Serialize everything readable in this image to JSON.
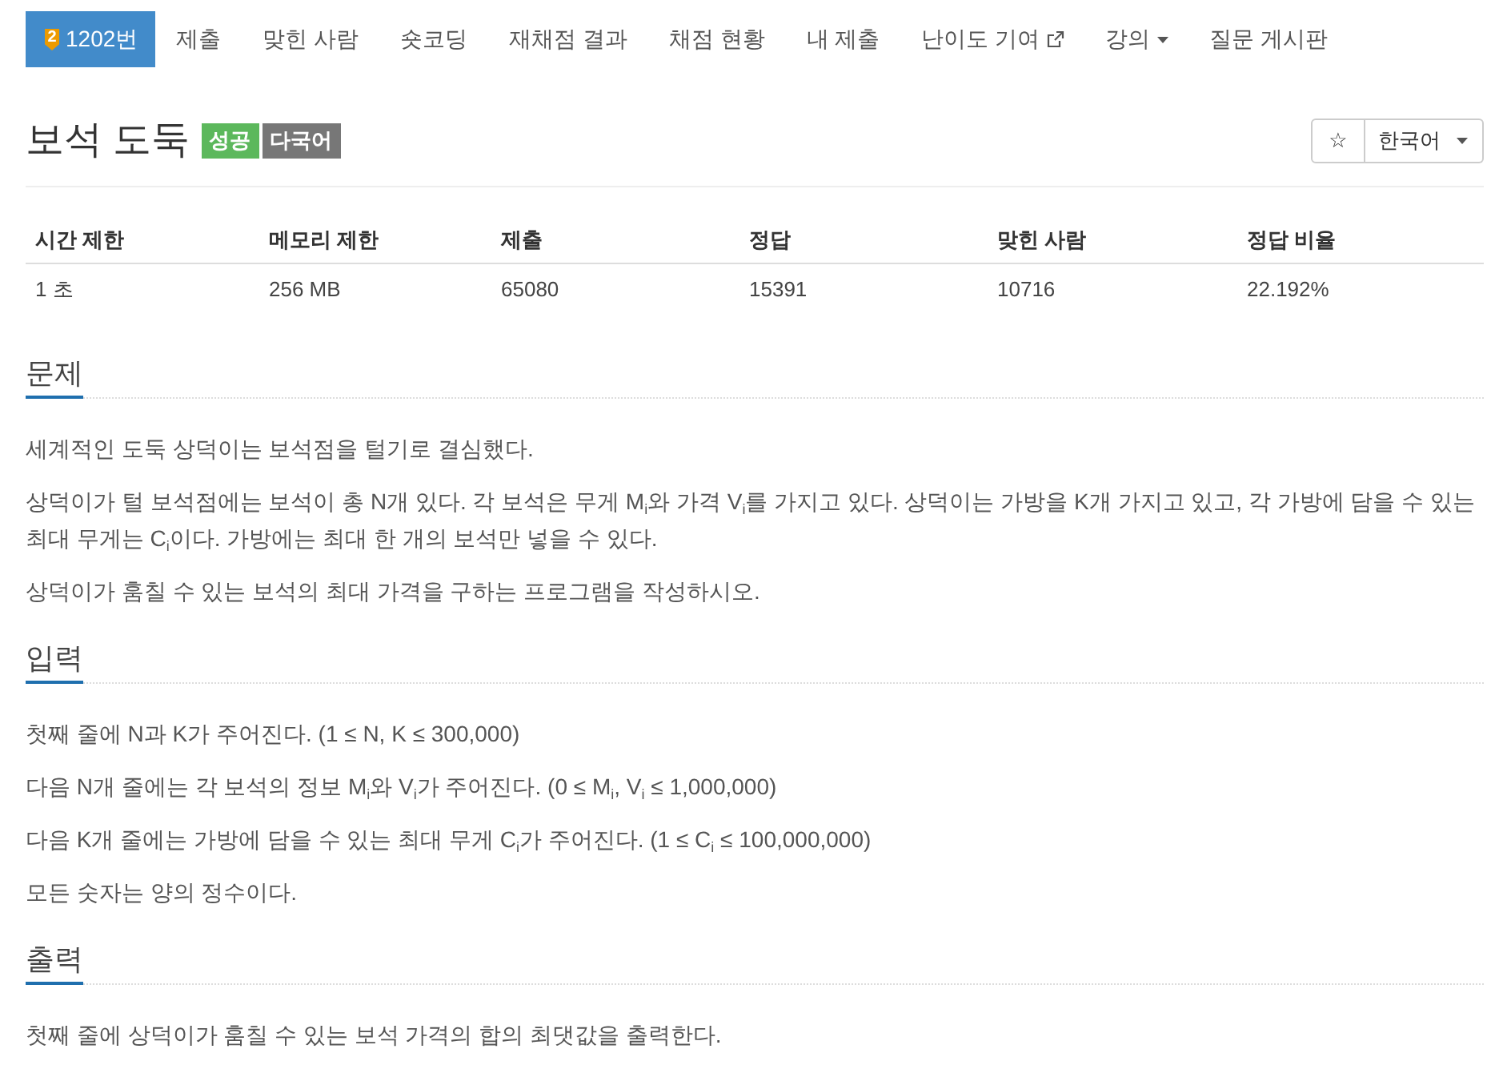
{
  "nav": {
    "items": [
      {
        "label": "1202번",
        "badge": "2",
        "kind": "problem",
        "selected": true
      },
      {
        "label": "제출",
        "kind": "link",
        "selected": false
      },
      {
        "label": "맞힌 사람",
        "kind": "link",
        "selected": false
      },
      {
        "label": "숏코딩",
        "kind": "link",
        "selected": false
      },
      {
        "label": "재채점 결과",
        "kind": "link",
        "selected": false
      },
      {
        "label": "채점 현황",
        "kind": "link",
        "selected": false
      },
      {
        "label": "내 제출",
        "kind": "link",
        "selected": false
      },
      {
        "label": "난이도 기여",
        "kind": "external",
        "selected": false
      },
      {
        "label": "강의",
        "kind": "dropdown",
        "selected": false
      },
      {
        "label": "질문 게시판",
        "kind": "link",
        "selected": false
      }
    ]
  },
  "header": {
    "title": "보석 도둑",
    "labels": [
      {
        "text": "성공",
        "color": "#5cb85c"
      },
      {
        "text": "다국어",
        "color": "#777777"
      }
    ],
    "star": "☆",
    "language": "한국어"
  },
  "stats": {
    "columns": [
      "시간 제한",
      "메모리 제한",
      "제출",
      "정답",
      "맞힌 사람",
      "정답 비율"
    ],
    "rows": [
      [
        "1 초",
        "256 MB",
        "65080",
        "15391",
        "10716",
        "22.192%"
      ]
    ]
  },
  "sections": [
    {
      "heading": "문제",
      "paragraphs": [
        "세계적인 도둑 상덕이는 보석점을 털기로 결심했다.",
        "상덕이가 털 보석점에는 보석이 총 N개 있다. 각 보석은 무게 M$_{i}$와 가격 V$_{i}$를 가지고 있다. 상덕이는 가방을 K개 가지고 있고, 각 가방에 담을 수 있는 최대 무게는 C$_{i}$이다. 가방에는 최대 한 개의 보석만 넣을 수 있다.",
        "상덕이가 훔칠 수 있는 보석의 최대 가격을 구하는 프로그램을 작성하시오."
      ]
    },
    {
      "heading": "입력",
      "paragraphs": [
        "첫째 줄에 N과 K가 주어진다. (1 ≤ N, K ≤ 300,000)",
        "다음 N개 줄에는 각 보석의 정보 M$_{i}$와 V$_{i}$가 주어진다. (0 ≤ M$_{i}$, V$_{i}$ ≤ 1,000,000)",
        "다음 K개 줄에는 가방에 담을 수 있는 최대 무게 C$_{i}$가 주어진다. (1 ≤ C$_{i}$ ≤ 100,000,000)",
        "모든 숫자는 양의 정수이다."
      ]
    },
    {
      "heading": "출력",
      "paragraphs": [
        "첫째 줄에 상덕이가 훔칠 수 있는 보석 가격의 합의 최댓값을 출력한다."
      ]
    }
  ]
}
